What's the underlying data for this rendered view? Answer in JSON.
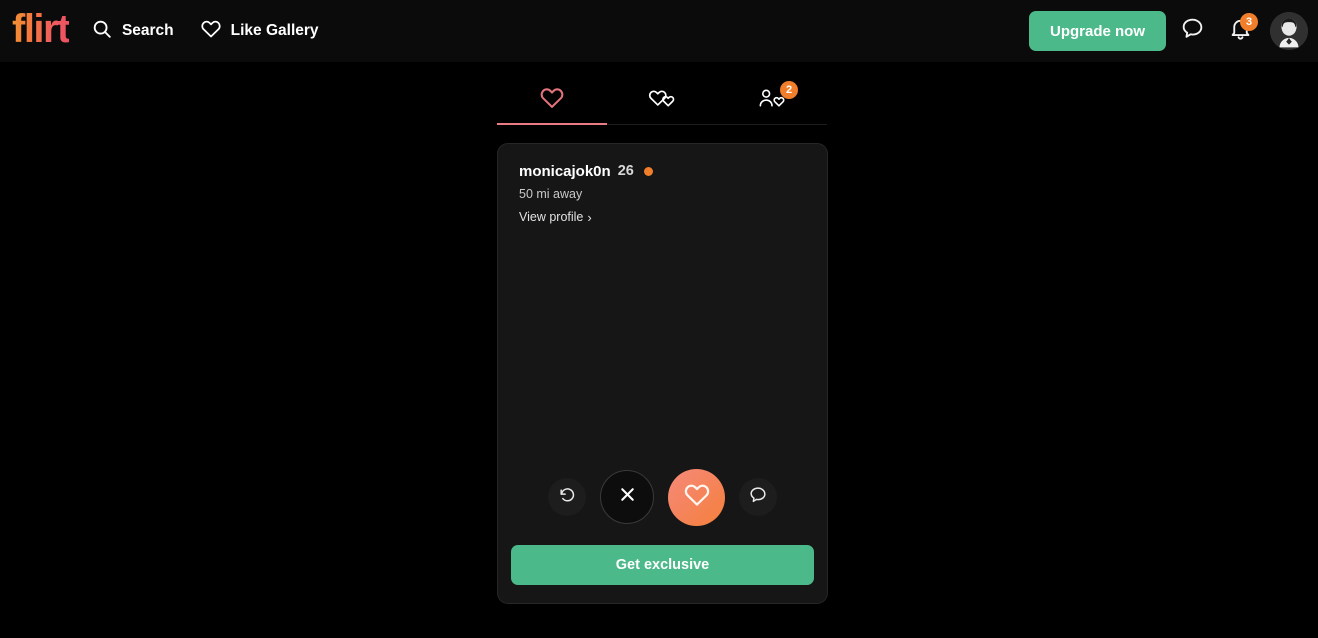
{
  "header": {
    "logo_text": "flirt",
    "logo_gradient_from": "#f39233",
    "logo_gradient_to": "#ec4f63",
    "nav": [
      {
        "label": "Search",
        "icon": "search-icon"
      },
      {
        "label": "Like Gallery",
        "icon": "heart-outline-icon"
      }
    ],
    "upgrade_label": "Upgrade now",
    "upgrade_color": "#4cb98a",
    "messages_icon": "chat-bubble-icon",
    "notifications_icon": "bell-icon",
    "notifications_badge": "3",
    "badge_color": "#f07e2b",
    "avatar_alt": "user-avatar"
  },
  "tabs": [
    {
      "name": "likes",
      "icon": "heart-outline-icon",
      "active": true,
      "badge": ""
    },
    {
      "name": "matches",
      "icon": "double-heart-icon",
      "active": false,
      "badge": ""
    },
    {
      "name": "visitors",
      "icon": "person-heart-icon",
      "active": false,
      "badge": "2"
    }
  ],
  "tab_indicator_color": "#e87b84",
  "card": {
    "username": "monicajok0n",
    "age": "26",
    "online": true,
    "online_color": "#f07e2b",
    "distance": "50 mi away",
    "view_profile_label": "View profile",
    "chevron": "›",
    "actions": [
      {
        "name": "rewind-button",
        "icon": "undo-arrow-icon",
        "size": "small"
      },
      {
        "name": "dislike-button",
        "icon": "close-x-icon",
        "size": "large"
      },
      {
        "name": "like-button",
        "icon": "heart-filled-icon",
        "size": "large-accent"
      },
      {
        "name": "message-button",
        "icon": "chat-bubble-icon",
        "size": "small"
      }
    ],
    "cta_label": "Get exclusive",
    "cta_color": "#4cb98a"
  }
}
